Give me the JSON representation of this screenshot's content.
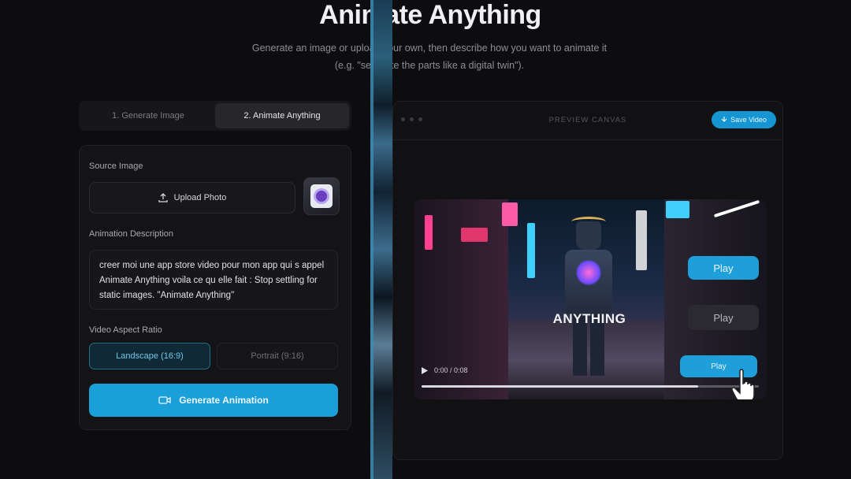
{
  "header": {
    "title": "Animate Anything",
    "subtitle": "Generate an image or upload your own, then describe how you want to animate it (e.g. \"separate the parts like a digital twin\")."
  },
  "tabs": [
    {
      "label": "1. Generate Image",
      "active": false
    },
    {
      "label": "2. Animate Anything",
      "active": true
    }
  ],
  "left_panel": {
    "source_label": "Source Image",
    "upload_label": "Upload Photo",
    "description_label": "Animation Description",
    "description_value": "creer moi une app store video pour mon app qui s appel Animate Anything voila ce qu elle fait : Stop settling for static images. \"Animate Anything\"",
    "aspect_label": "Video Aspect Ratio",
    "aspect_options": [
      {
        "label": "Landscape (16:9)",
        "active": true
      },
      {
        "label": "Portrait (9:16)",
        "active": false
      }
    ],
    "generate_label": "Generate Animation"
  },
  "right_panel": {
    "canvas_label": "PREVIEW CANVAS",
    "save_label": "Save Video"
  },
  "video": {
    "overlay_text": "ANYTHING",
    "buttons": [
      "Play",
      "Play",
      "Play"
    ],
    "timecode": "0:00 / 0:08",
    "progress": 0.82
  },
  "colors": {
    "accent": "#1a9fd8",
    "background": "#0d0d10",
    "panel": "#141417"
  }
}
